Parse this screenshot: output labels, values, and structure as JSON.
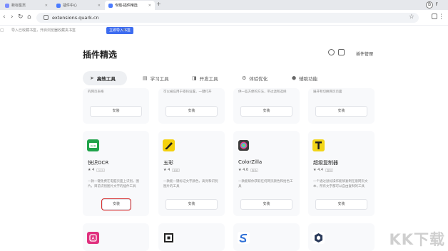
{
  "browser": {
    "tabs": [
      {
        "label": "新标签页",
        "active": false
      },
      {
        "label": "插件中心",
        "active": false
      },
      {
        "label": "专题-插件精选",
        "active": true
      }
    ],
    "new_tab": "+",
    "profile_initial": "B",
    "profile_label": "F",
    "url": "extensions.quark.cn",
    "bookmarks_text": "导入已收藏书签，开启浏览器收藏夹书签",
    "import_label": "立即导入书签",
    "bookmarks_close": "×"
  },
  "page": {
    "title": "插件精选",
    "manage_label": "插件管理",
    "categories": [
      {
        "label": "高效工具",
        "icon": "paper-plane-icon",
        "glyph": "➤",
        "active": true
      },
      {
        "label": "学习工具",
        "icon": "book-icon",
        "glyph": "▤",
        "active": false
      },
      {
        "label": "开发工具",
        "icon": "code-icon",
        "glyph": "◨",
        "active": false
      },
      {
        "label": "体验优化",
        "icon": "settings-icon",
        "glyph": "⚙",
        "active": false
      },
      {
        "label": "辅助功能",
        "icon": "shield-icon",
        "glyph": "⬢",
        "active": false
      }
    ]
  },
  "top_row": [
    {
      "desc": "的网页表格",
      "install": "安装"
    },
    {
      "desc": "可以被应用于密码设置，一键打开",
      "install": "安装"
    },
    {
      "desc": "供一些方便的方法，带过滤和选择",
      "install": "安装"
    },
    {
      "desc": "展开和切换网页页面",
      "install": "安装"
    }
  ],
  "extensions": [
    {
      "name": "快识OCR",
      "rating": "★ 4",
      "tag": "OCR",
      "desc": "一款一键免费在电脑页面上识别，图片，目前识别图片文字的插件工具",
      "install": "安装",
      "icon": "ocr-icon",
      "color": "#1fa34a",
      "highlight": true
    },
    {
      "name": "五彩",
      "rating": "★ 4",
      "tag": "划线",
      "desc": "一款能一键标记文字颜色，高亮和识别图片的工具",
      "install": "安装",
      "icon": "highlighter-icon",
      "color": "#f4d10e",
      "highlight": false
    },
    {
      "name": "ColorZilla",
      "rating": "★ 4.6",
      "tag": "取色",
      "desc": "一款能帮你获取任何网页颜色和拾色工具",
      "install": "安装",
      "icon": "colorzilla-icon",
      "color": "#3b3b3b",
      "highlight": false
    },
    {
      "name": "超级复制器",
      "rating": "★ 4.4",
      "tag": "复制",
      "desc": "一个通过鼠标操作能够复制任意网页文本，所有文字都可以自由复制的工具",
      "install": "安装",
      "icon": "copy-tool-icon",
      "color": "#f2d517",
      "highlight": false
    }
  ],
  "bottom_row": [
    {
      "icon": "translate-icon",
      "color": "#e0307e"
    },
    {
      "icon": "qr-icon",
      "color": "#222222"
    },
    {
      "icon": "s-logo-icon",
      "color": "#2d6fd6"
    },
    {
      "icon": "cube-icon",
      "color": "#2a3a5a"
    }
  ],
  "watermark": "KK下载"
}
